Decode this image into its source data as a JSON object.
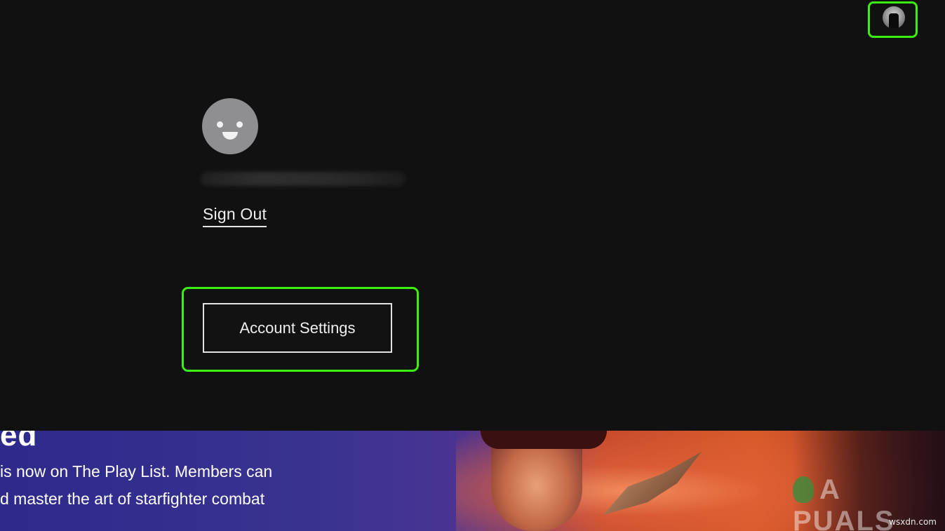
{
  "header": {
    "profile_icon": "user-avatar-icon"
  },
  "account_panel": {
    "avatar_icon": "smiley-face-avatar-icon",
    "sign_out_label": "Sign Out",
    "account_settings_label": "Account Settings"
  },
  "banner": {
    "title_fragment": "ed",
    "line_1": "is now on The Play List. Members can",
    "line_2": "d master the art of starfighter combat"
  },
  "watermark": {
    "text": "A  PUALS"
  },
  "site_credit": "wsxdn.com",
  "colors": {
    "background": "#111111",
    "highlight": "#3cf00f",
    "text": "#f0f0f0"
  }
}
